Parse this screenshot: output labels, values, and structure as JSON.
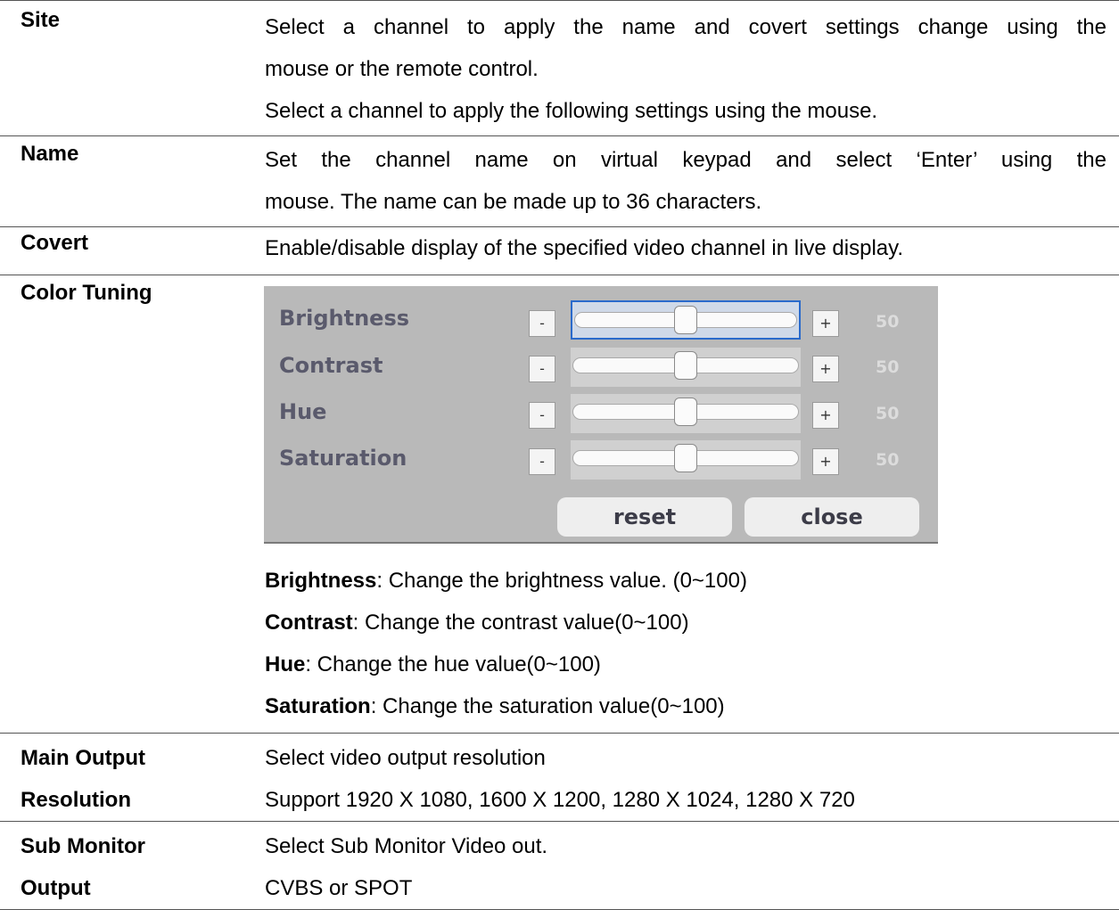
{
  "rows": {
    "site": {
      "term": "Site",
      "lines": [
        "Select a channel to apply the name and covert settings change using the",
        "mouse or the remote control.",
        "Select a channel to apply the following settings using the mouse."
      ]
    },
    "name": {
      "term": "Name",
      "lines": [
        "Set the channel name on virtual keypad and select ‘Enter’ using the",
        "mouse. The name can be made up to 36 characters."
      ]
    },
    "covert": {
      "term": "Covert",
      "lines": [
        "Enable/disable display of the specified video channel in live display."
      ]
    },
    "color_tuning": {
      "term": "Color Tuning",
      "panel": {
        "sliders": [
          {
            "label": "Brightness",
            "minus": "-",
            "plus": "+",
            "value": "50",
            "level": 0.5
          },
          {
            "label": "Contrast",
            "minus": "-",
            "plus": "+",
            "value": "50",
            "level": 0.5
          },
          {
            "label": "Hue",
            "minus": "-",
            "plus": "+",
            "value": "50",
            "level": 0.5
          },
          {
            "label": "Saturation",
            "minus": "-",
            "plus": "+",
            "value": "50",
            "level": 0.5
          }
        ],
        "reset_label": "reset",
        "close_label": "close"
      },
      "notes": [
        {
          "key": "Brightness",
          "text": ": Change the brightness value. (0~100)"
        },
        {
          "key": "Contrast",
          "text": ": Change the contrast value(0~100)"
        },
        {
          "key": "Hue",
          "text": ": Change the hue value(0~100)"
        },
        {
          "key": "Saturation",
          "text": ": Change the saturation value(0~100)"
        }
      ]
    },
    "main_output": {
      "term_lines": [
        "Main Output",
        "Resolution"
      ],
      "lines": [
        "Select video output resolution",
        "Support 1920 X 1080, 1600 X 1200, 1280 X 1024, 1280 X 720"
      ]
    },
    "sub_monitor": {
      "term_lines": [
        "Sub Monitor",
        "Output"
      ],
      "lines": [
        "Select Sub Monitor Video out.",
        "CVBS or SPOT"
      ]
    }
  }
}
